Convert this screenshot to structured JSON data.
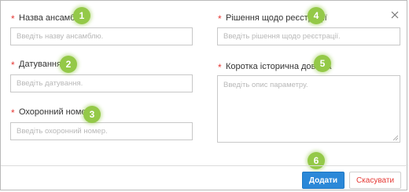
{
  "dialog": {
    "close_icon": "close-icon",
    "fields": {
      "ensemble_name": {
        "label": "Назва ансамблю",
        "required_mark": "*",
        "placeholder": "Введіть назву ансамблю."
      },
      "dating": {
        "label": "Датування",
        "required_mark": "*",
        "placeholder": "Введіть датування."
      },
      "protection_number": {
        "label": "Охоронний номер",
        "required_mark": "*",
        "placeholder": "Введіть охоронний номер."
      },
      "registry_decision": {
        "label": "Рішення щодо реєстрації",
        "required_mark": "*",
        "placeholder": "Введіть рішення щодо реєстрації."
      },
      "history_note": {
        "label": "Коротка історична довідка",
        "required_mark": "*",
        "placeholder": "Введіть опис параметру."
      }
    },
    "badges": [
      "1",
      "2",
      "3",
      "4",
      "5",
      "6"
    ],
    "buttons": {
      "add": "Додати",
      "cancel": "Скасувати"
    },
    "colors": {
      "primary": "#2b88d8",
      "required": "#e53935",
      "badge": "#94c948",
      "cancel_text": "#e53935"
    }
  }
}
